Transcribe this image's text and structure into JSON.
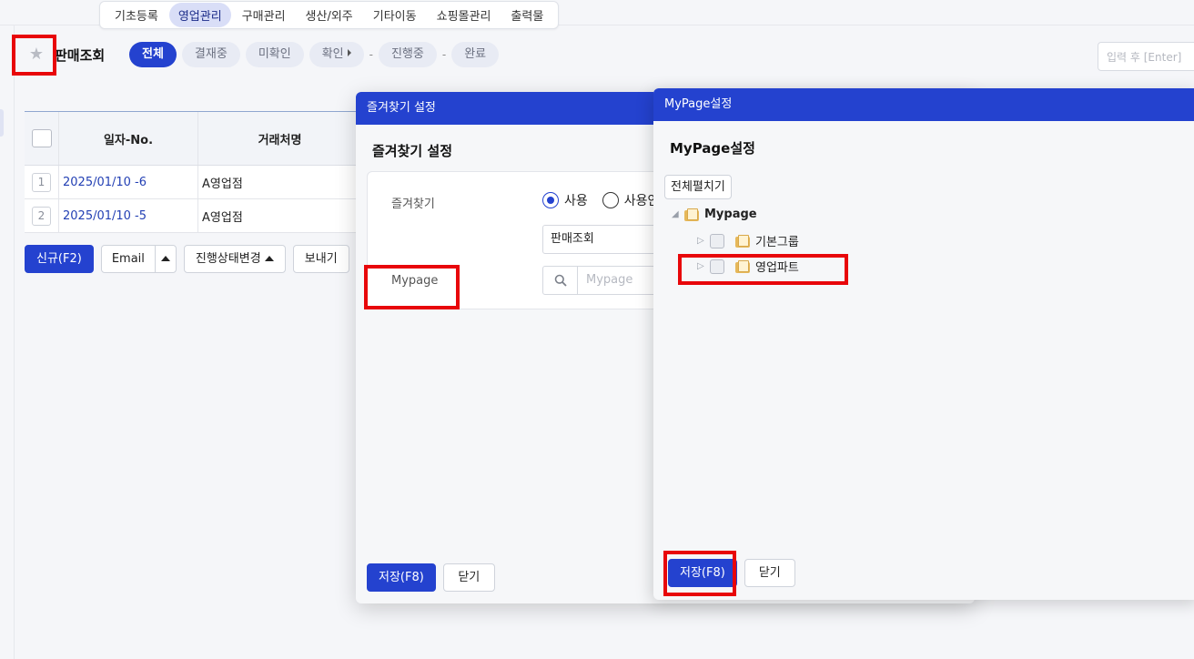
{
  "topmenu": {
    "items": [
      "기초등록",
      "영업관리",
      "구매관리",
      "생산/외주",
      "기타이동",
      "쇼핑몰관리",
      "출력물"
    ],
    "active_index": 1
  },
  "page": {
    "title": "판매조회",
    "favorite_icon": "star-icon",
    "status_tabs": {
      "all": "전체",
      "in_approval": "결재중",
      "unconfirmed": "미확인",
      "confirmed": "확인",
      "dash1": "-",
      "in_progress": "진행중",
      "dash2": "-",
      "done": "완료"
    },
    "search_placeholder": "입력 후 [Enter]"
  },
  "grid": {
    "columns": {
      "date_no": "일자-No.",
      "customer": "거래처명"
    },
    "rows": [
      {
        "num": "1",
        "date_no": "2025/01/10 -6",
        "customer": "A영업점"
      },
      {
        "num": "2",
        "date_no": "2025/01/10 -5",
        "customer": "A영업점"
      }
    ]
  },
  "buttons": {
    "new": "신규(F2)",
    "email": "Email",
    "change_status": "진행상태변경",
    "send": "보내기"
  },
  "favorites_dialog": {
    "header": "즐겨찾기 설정",
    "subtitle": "즐겨찾기 설정",
    "label_favorite": "즐겨찾기",
    "option_use": "사용",
    "option_notuse": "사용안",
    "name_value": "판매조회",
    "label_mypage": "Mypage",
    "mypage_placeholder": "Mypage",
    "save": "저장(F8)",
    "close": "닫기"
  },
  "mypage_dialog": {
    "header": "MyPage설정",
    "subtitle": "MyPage설정",
    "expand_all": "전체펼치기",
    "tree": {
      "root": "Mypage",
      "children": [
        "기본그룹",
        "영업파트"
      ]
    },
    "save": "저장(F8)",
    "close": "닫기"
  },
  "colors": {
    "accent": "#2442cf",
    "highlight": "#e8060a"
  }
}
